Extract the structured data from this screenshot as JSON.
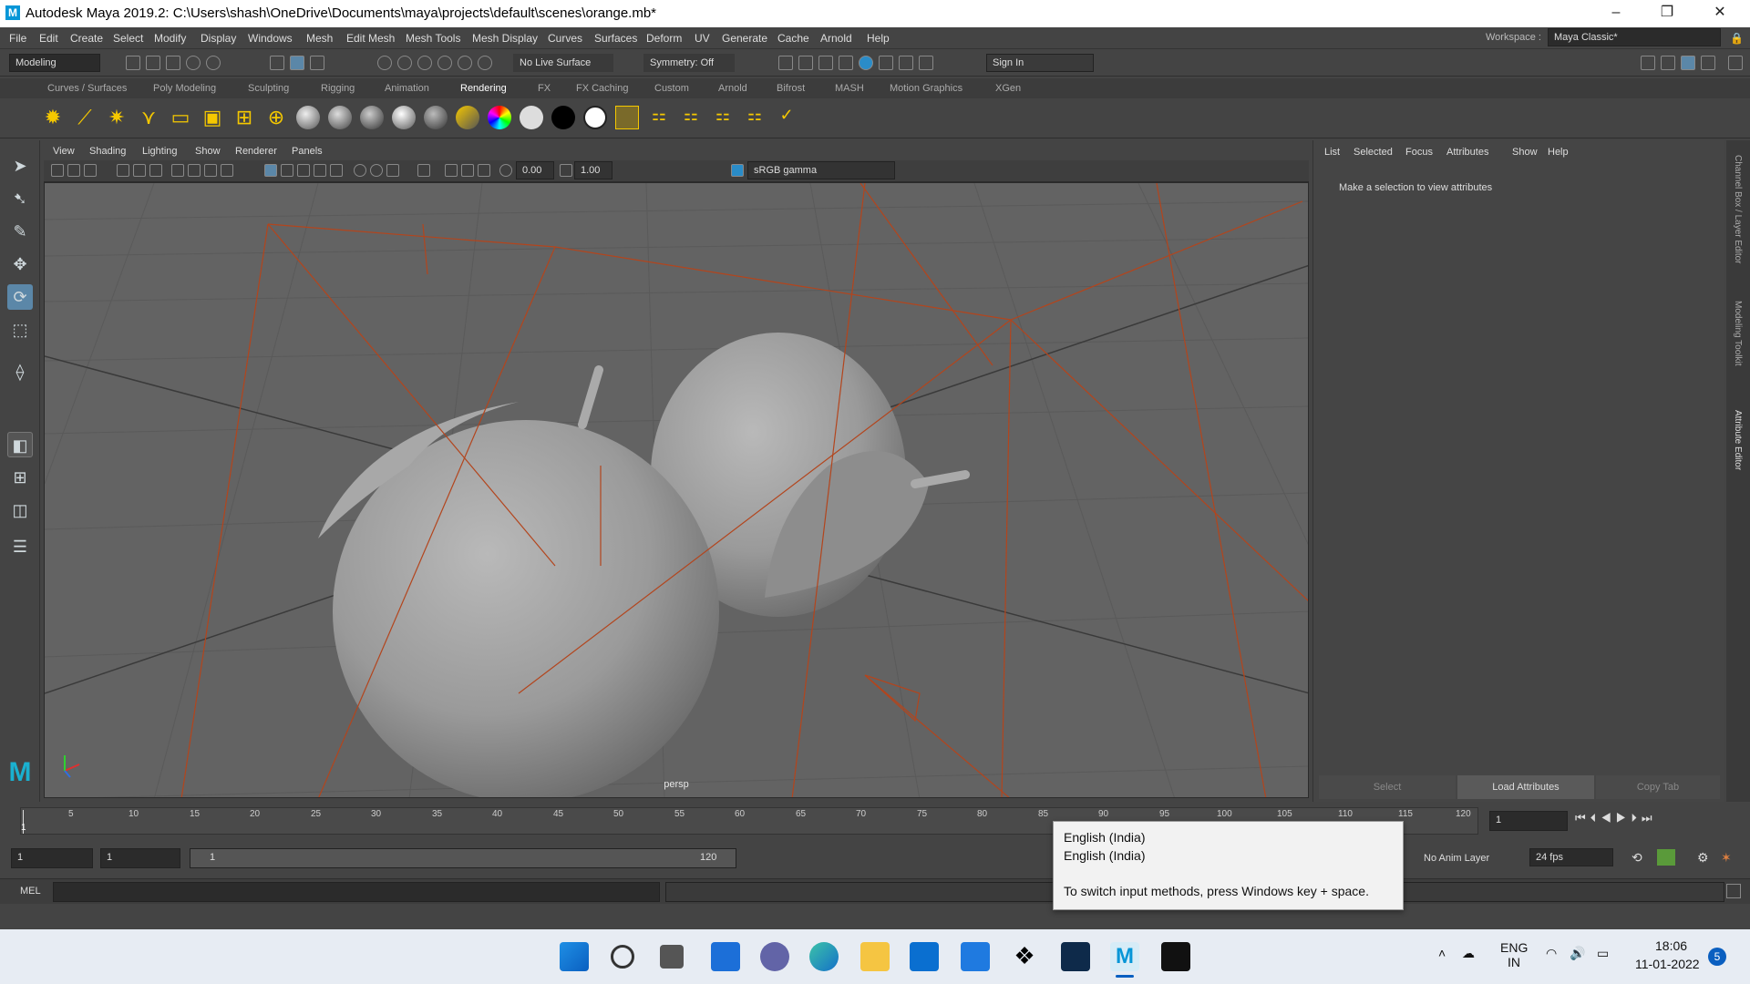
{
  "window": {
    "title": "Autodesk Maya 2019.2: C:\\Users\\shash\\OneDrive\\Documents\\maya\\projects\\default\\scenes\\orange.mb*",
    "logo": "M",
    "minimize": "–",
    "restore": "❐",
    "close": "✕"
  },
  "menubar": {
    "items": [
      "File",
      "Edit",
      "Create",
      "Select",
      "Modify",
      "Display",
      "Windows",
      "Mesh",
      "Edit Mesh",
      "Mesh Tools",
      "Mesh Display",
      "Curves",
      "Surfaces",
      "Deform",
      "UV",
      "Generate",
      "Cache",
      "Arnold",
      "Help"
    ],
    "workspace_label": "Workspace :",
    "workspace_value": "Maya Classic*"
  },
  "statusline": {
    "mode": "Modeling",
    "live_surface": "No Live Surface",
    "symmetry": "Symmetry: Off",
    "sign_in": "Sign In"
  },
  "shelf": {
    "tabs": [
      "Curves / Surfaces",
      "Poly Modeling",
      "Sculpting",
      "Rigging",
      "Animation",
      "Rendering",
      "FX",
      "FX Caching",
      "Custom",
      "Arnold",
      "Bifrost",
      "MASH",
      "Motion Graphics",
      "XGen"
    ],
    "active_tab": "Rendering"
  },
  "viewport": {
    "menus": [
      "View",
      "Shading",
      "Lighting",
      "Show",
      "Renderer",
      "Panels"
    ],
    "exposure": "0.00",
    "gamma": "1.00",
    "colorspace": "sRGB gamma",
    "camera_label": "persp"
  },
  "attribute_editor": {
    "menus": [
      "List",
      "Selected",
      "Focus",
      "Attributes",
      "Show",
      "Help"
    ],
    "message": "Make a selection to view attributes",
    "buttons": [
      "Select",
      "Load Attributes",
      "Copy Tab"
    ],
    "side_tabs": [
      "Channel Box / Layer Editor",
      "Modeling Toolkit",
      "Attribute Editor"
    ]
  },
  "timeline": {
    "ticks": [
      "5",
      "10",
      "15",
      "20",
      "25",
      "30",
      "35",
      "40",
      "45",
      "50",
      "55",
      "60",
      "65",
      "70",
      "75",
      "80",
      "85",
      "90",
      "95",
      "100",
      "105",
      "110",
      "115",
      "120"
    ],
    "current_frame_marker": "1",
    "current_frame": "1"
  },
  "range": {
    "start": "1",
    "playback_start": "1",
    "slider_start": "1",
    "slider_end": "120",
    "anim_layer": "No Anim Layer",
    "fps": "24 fps"
  },
  "command": {
    "language": "MEL"
  },
  "tooltip": {
    "line1": "English (India)",
    "line2": "English (India)",
    "line3": "To switch input methods, press Windows key + space."
  },
  "taskbar": {
    "lang_top": "ENG",
    "lang_bottom": "IN",
    "time": "18:06",
    "date": "11-01-2022",
    "notification_count": "5"
  }
}
